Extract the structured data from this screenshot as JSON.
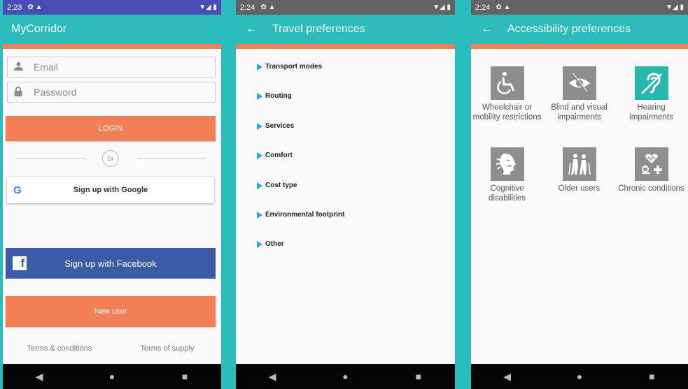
{
  "screens": {
    "login": {
      "status": {
        "time": "2:23",
        "icons": "✿ ▲",
        "right": "▼◢ ▮"
      },
      "app_title": "MyCorridor",
      "email_placeholder": "Email",
      "password_placeholder": "Password",
      "login_label": "LOGIN",
      "or_label": "Or",
      "google_label": "Sign up with Google",
      "facebook_label": "Sign up with Facebook",
      "new_user_label": "New user",
      "terms_label": "Terms & conditions",
      "supply_label": "Terms of supply"
    },
    "travel": {
      "status": {
        "time": "2:24",
        "icons": "✿ ▲",
        "right": "▼◢ ▮"
      },
      "title": "Travel preferences",
      "items": [
        "Transport modes",
        "Routing",
        "Services",
        "Comfort",
        "Cost type",
        "Environmental footprint",
        "Other"
      ]
    },
    "accessibility": {
      "status": {
        "time": "2:24",
        "icons": "✿ ▲",
        "right": "▼◢ ▮"
      },
      "title": "Accessibility preferences",
      "items": [
        {
          "label": "Wheelchair or mobility restrictions",
          "icon": "wheelchair-icon",
          "selected": false
        },
        {
          "label": "Blind and visual impairments",
          "icon": "blind-icon",
          "selected": false
        },
        {
          "label": "Hearing impairments",
          "icon": "hearing-icon",
          "selected": true
        },
        {
          "label": "Cognitive disabilities",
          "icon": "cognitive-icon",
          "selected": false
        },
        {
          "label": "Older users",
          "icon": "older-users-icon",
          "selected": false
        },
        {
          "label": "Chronic conditions",
          "icon": "chronic-icon",
          "selected": false
        }
      ]
    }
  },
  "nav": {
    "back": "◀",
    "home": "●",
    "recents": "■"
  },
  "colors": {
    "teal": "#2cbcbc",
    "orange": "#f37f56",
    "facebook": "#3b5ba6",
    "icon_gray": "#8e8e8e",
    "icon_active": "#27b8ab"
  }
}
